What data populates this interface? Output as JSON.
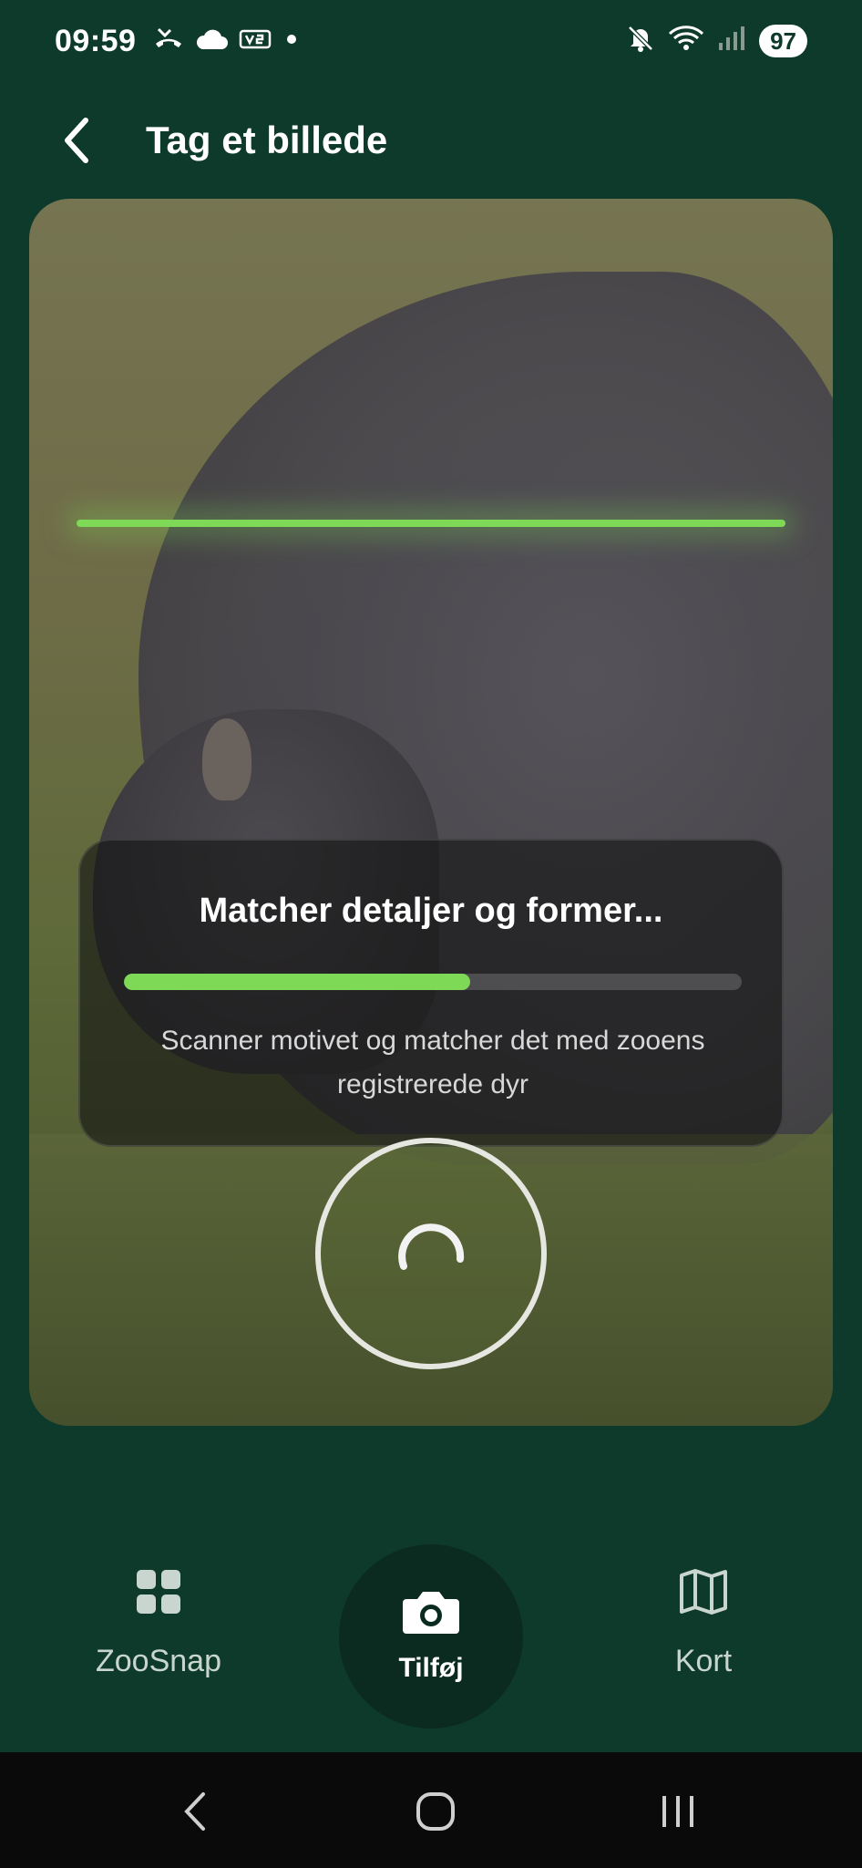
{
  "status_bar": {
    "time": "09:59",
    "battery": "97",
    "left_icons": [
      "missed-call-icon",
      "cloud-icon",
      "voice-over-lte-icon",
      "notification-dot-icon"
    ],
    "right_icons": [
      "mute-icon",
      "wifi-icon",
      "signal-icon"
    ]
  },
  "header": {
    "title": "Tag et billede",
    "back_icon": "chevron-left-icon"
  },
  "scan": {
    "title": "Matcher detaljer og former...",
    "progress": 0.56,
    "description": "Scanner motivet og matcher det med zooens registrerede dyr",
    "accent_color": "#7ed957"
  },
  "bottom_nav": {
    "items": [
      {
        "label": "ZooSnap",
        "icon": "grid-icon"
      },
      {
        "label": "Tilføj",
        "icon": "camera-icon"
      },
      {
        "label": "Kort",
        "icon": "map-icon"
      }
    ]
  },
  "theme": {
    "background": "#0e3a2c",
    "active_nav_bg": "#0b2a20"
  }
}
